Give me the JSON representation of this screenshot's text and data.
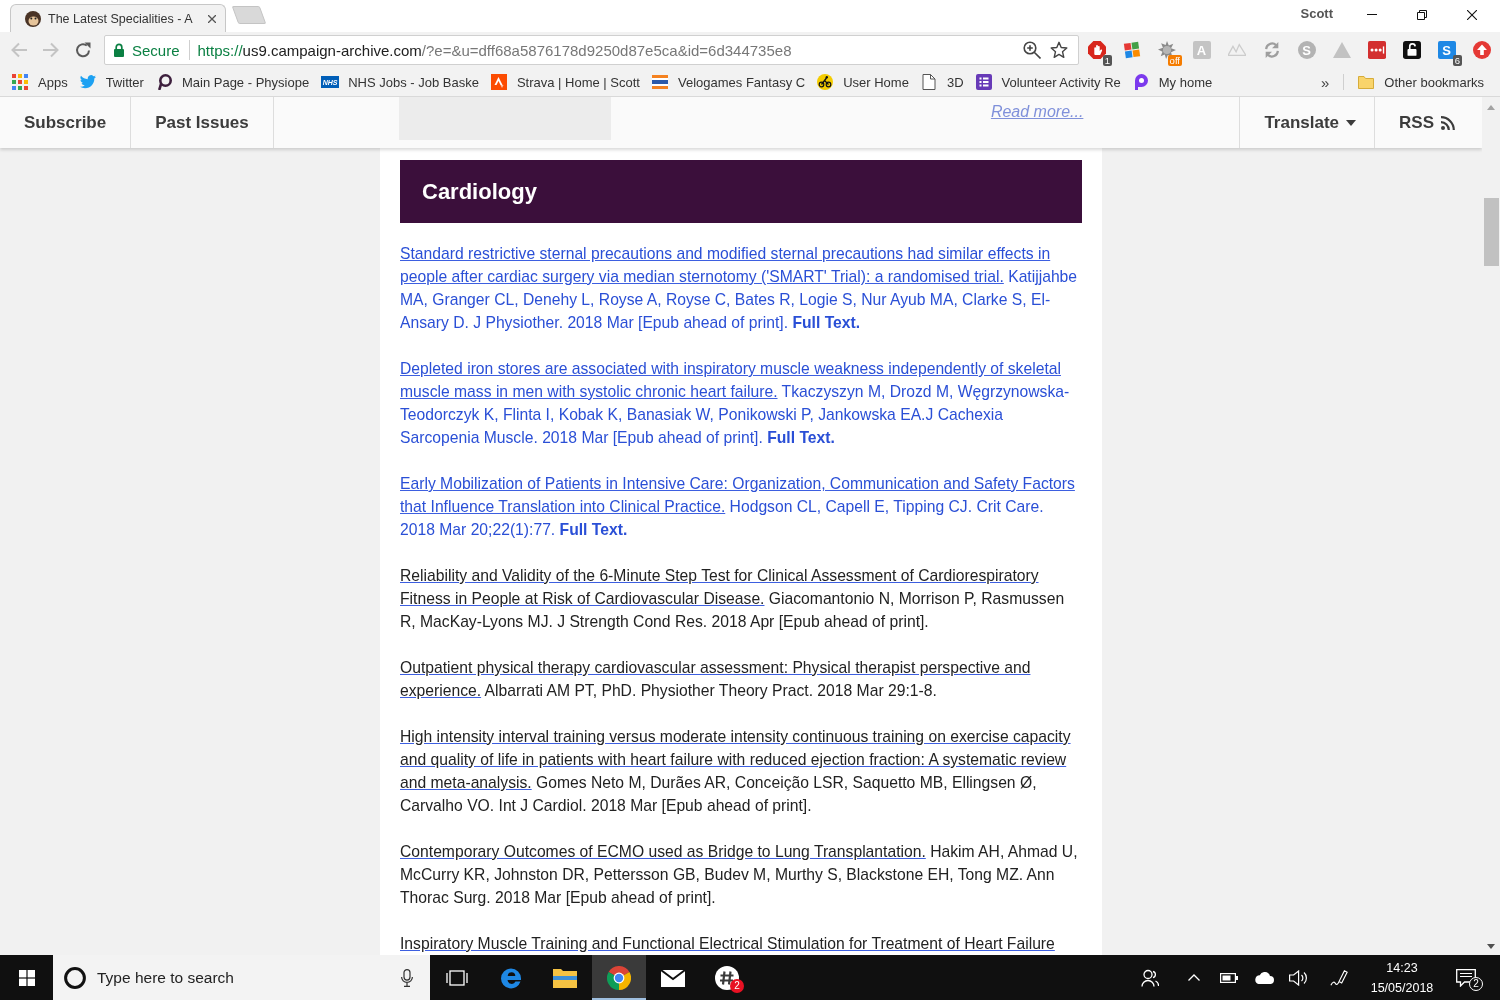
{
  "window": {
    "tabs": [
      {
        "title": "The Latest Specialities - A",
        "selected": true
      }
    ],
    "profile": "Scott"
  },
  "toolbar": {
    "back": {
      "disabled": true
    },
    "forward": {
      "disabled": true
    },
    "security_label": "Secure",
    "url": {
      "scheme": "https://",
      "host": "us9.campaign-archive.com",
      "path": "/?e=&u=dff68a5876178d9250d87e5ca&id=6d344735e8"
    },
    "extensions": [
      {
        "kind": "stop-hand",
        "badge": "1"
      },
      {
        "kind": "tiles"
      },
      {
        "kind": "spiky-ball",
        "badge": "off"
      },
      {
        "kind": "letter-tile",
        "glyph": "A",
        "color": "#c4c4c4"
      },
      {
        "kind": "mountains"
      },
      {
        "kind": "sync"
      },
      {
        "kind": "letter-circle",
        "glyph": "S"
      },
      {
        "kind": "triangle"
      },
      {
        "kind": "dots-tile"
      },
      {
        "kind": "padlock"
      },
      {
        "kind": "letter-tile",
        "glyph": "S",
        "color": "#1e88e5",
        "badge": "6"
      },
      {
        "kind": "up-arrow"
      }
    ]
  },
  "bookmarks": {
    "items": [
      {
        "kind": "apps-grid",
        "label": "Apps"
      },
      {
        "kind": "bird",
        "label": "Twitter"
      },
      {
        "kind": "loop",
        "label": "Main Page - Physiope"
      },
      {
        "kind": "text-tile",
        "glyph": "NHS",
        "label": "NHS Jobs - Job Baske"
      },
      {
        "kind": "peaks-tile",
        "label": "Strava | Home | Scott"
      },
      {
        "kind": "striped-flag",
        "label": "Velogames Fantasy C"
      },
      {
        "kind": "cyclist",
        "label": "User Home"
      },
      {
        "kind": "page",
        "label": "3D"
      },
      {
        "kind": "list-tile",
        "label": "Volunteer Activity Re"
      },
      {
        "kind": "pin",
        "label": "My home"
      }
    ],
    "overflow": "»",
    "other": {
      "kind": "folder",
      "label": "Other bookmarks"
    }
  },
  "newsletter": {
    "nav": [
      {
        "label": "Subscribe"
      },
      {
        "label": "Past Issues"
      }
    ],
    "read_more": "Read more...",
    "translate": "Translate",
    "rss": "RSS",
    "section": {
      "heading": "Cardiology",
      "articles": [
        {
          "title": "Standard restrictive sternal precautions and modified sternal precautions had similar effects in people after cardiac surgery via median sternotomy ('SMART' Trial): a randomised trial.",
          "details": "Katijjahbe MA, Granger CL, Denehy L, Royse A, Royse C, Bates R, Logie S, Nur Ayub MA, Clarke S, El-Ansary D. J Physiother. 2018 Mar [Epub ahead of print].",
          "full_text": "Full Text.",
          "color": "#2a4fd6"
        },
        {
          "title": "Depleted iron stores are associated with inspiratory muscle weakness independently of skeletal muscle mass in men with systolic chronic heart failure.",
          "details": "Tkaczyszyn M, Drozd M, Węgrzynowska-Teodorczyk K, Flinta I, Kobak K, Banasiak W, Ponikowski P, Jankowska EA.J Cachexia Sarcopenia Muscle. 2018 Mar [Epub ahead of print].",
          "full_text": "Full Text.",
          "color": "#2a4fd6"
        },
        {
          "title": "Early Mobilization of Patients in Intensive Care: Organization, Communication and Safety Factors that Influence Translation into Clinical Practice.",
          "details": "Hodgson CL, Capell E, Tipping CJ. Crit Care. 2018 Mar 20;22(1):77.",
          "full_text": "Full Text.",
          "color": "#2a4fd6"
        },
        {
          "title": "Reliability and Validity of the 6-Minute Step Test for Clinical Assessment of Cardiorespiratory Fitness in People at Risk of Cardiovascular Disease.",
          "details": "Giacomantonio N, Morrison P, Rasmussen R, MacKay-Lyons MJ. J Strength Cond Res. 2018 Apr [Epub ahead of print].",
          "color": "#222222"
        },
        {
          "title": "Outpatient physical therapy cardiovascular assessment: Physical therapist perspective and experience.",
          "details": "Albarrati AM PT, PhD. Physiother Theory Pract. 2018 Mar 29:1-8.",
          "color": "#222222"
        },
        {
          "title": "High intensity interval training versus moderate intensity continuous training on exercise capacity and quality of life in patients with heart failure with reduced ejection fraction: A systematic review and meta-analysis.",
          "details": "Gomes Neto M, Durães AR, Conceição LSR, Saquetto MB, Ellingsen Ø, Carvalho VO. Int J Cardiol. 2018 Mar [Epub ahead of print].",
          "color": "#222222"
        },
        {
          "title": "Contemporary Outcomes of ECMO used as Bridge to Lung Transplantation.",
          "details": "Hakim AH, Ahmad U, McCurry KR, Johnston DR, Pettersson GB, Budev M, Murthy S, Blackstone EH, Tong MZ. Ann Thorac Surg. 2018 Mar [Epub ahead of print].",
          "color": "#222222"
        },
        {
          "title": "Inspiratory Muscle Training and Functional Electrical Stimulation for Treatment of Heart Failure",
          "color": "#222222"
        }
      ]
    }
  },
  "taskbar": {
    "search": {
      "placeholder": "Type here to search"
    },
    "apps": [
      {
        "kind": "swirl",
        "selected": false
      },
      {
        "kind": "folder",
        "selected": false
      },
      {
        "kind": "circle-logo",
        "selected": true
      },
      {
        "kind": "envelope",
        "selected": false
      },
      {
        "kind": "hash-circle",
        "selected": false,
        "badge": "2"
      }
    ],
    "time": "14:23",
    "date": "15/05/2018",
    "notification_count": "2"
  }
}
